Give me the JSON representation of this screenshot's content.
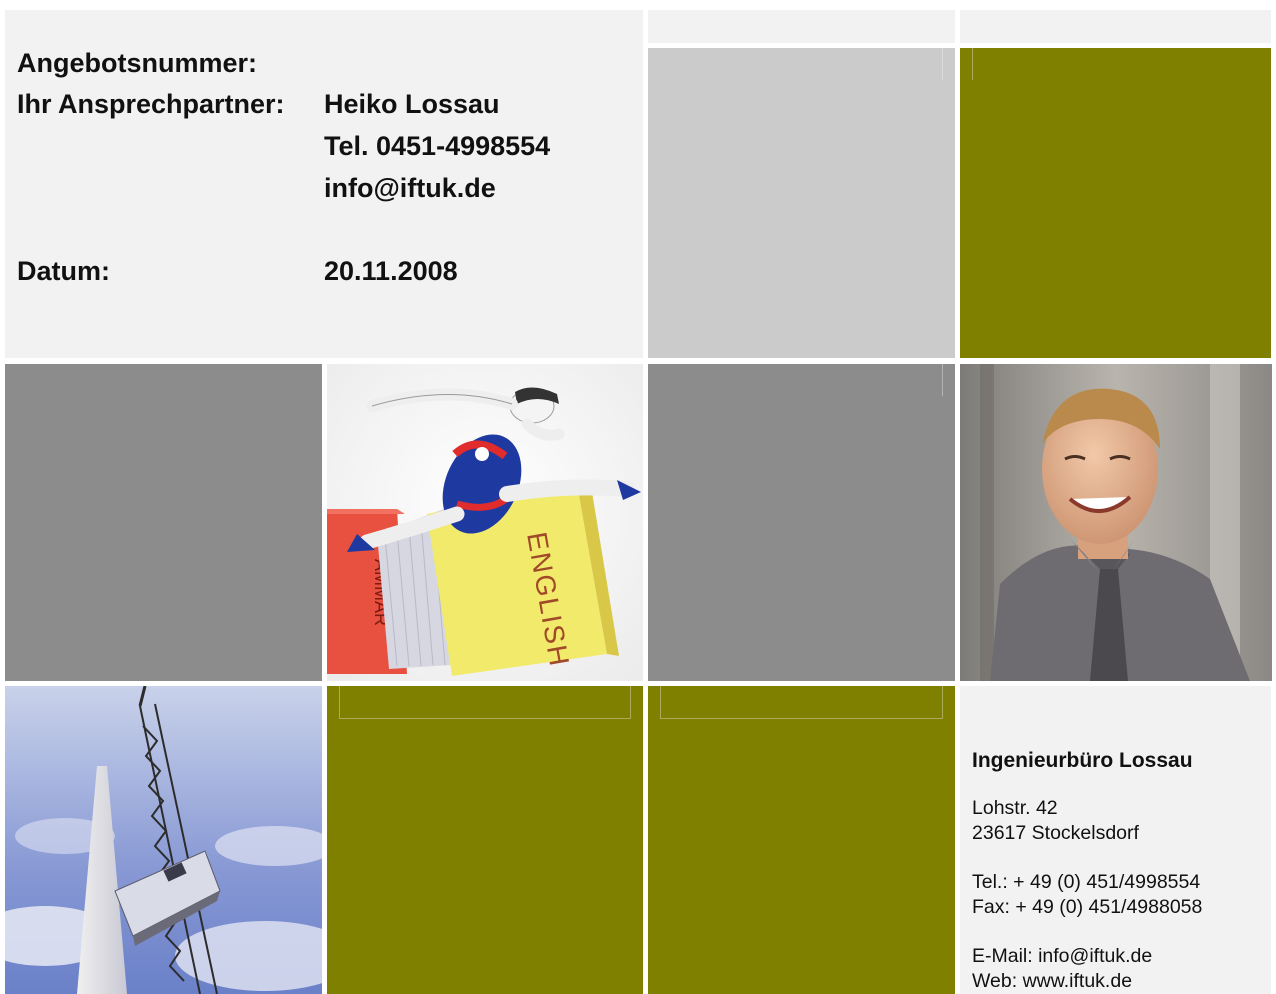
{
  "header": {
    "offer_label": "Angebotsnummer:",
    "contact_label": "Ihr Ansprechpartner:",
    "contact_name": "Heiko Lossau",
    "contact_phone": "Tel. 0451-4998554",
    "contact_email": "info@iftuk.de",
    "date_label": "Datum:",
    "date_value": "20.11.2008"
  },
  "tiles": {
    "english_book_text": "ENGLISH",
    "grammar_book_text": "AMMAR"
  },
  "company": {
    "name": "Ingenieurbüro Lossau",
    "street": "Lohstr. 42",
    "city": "23617 Stockelsdorf",
    "phone": "Tel.: + 49 (0) 451/4998554",
    "fax": "Fax: + 49 (0) 451/4988058",
    "email": "E-Mail: info@iftuk.de",
    "web": "Web: www.iftuk.de"
  },
  "colors": {
    "olive": "#7f7f00",
    "light_grey": "#cbcbcb",
    "mid_grey": "#8c8c8c",
    "pale_grey": "#f2f2f2"
  }
}
